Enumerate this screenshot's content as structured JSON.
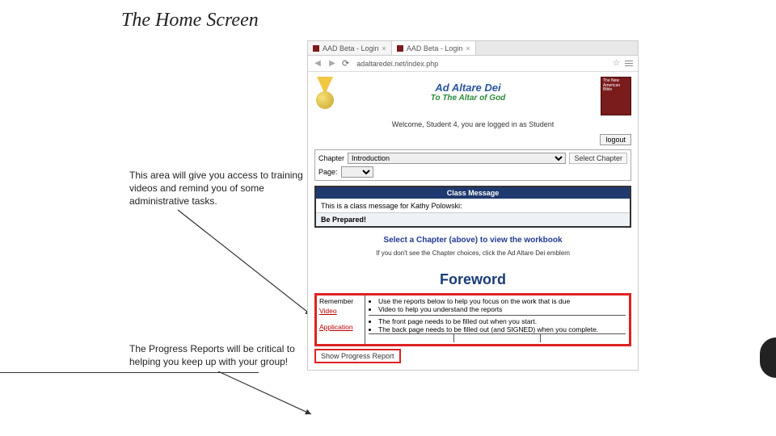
{
  "slide": {
    "title": "The Home Screen",
    "annotations": {
      "training": "This area will give you access to training videos and remind you of some administrative tasks.",
      "progress": "The Progress Reports will be critical to helping you keep up with your group!"
    }
  },
  "browser": {
    "tabs": [
      {
        "label": "AAD Beta - Login",
        "active": false
      },
      {
        "label": "AAD Beta - Login",
        "active": true
      }
    ],
    "url": "adaltaredei.net/index.php"
  },
  "site": {
    "title1": "Ad Altare Dei",
    "title2": "To The Altar of God",
    "bible_label": "The New American Bible",
    "welcome": "Welcome, Student 4, you are logged in as Student",
    "logout": "logout",
    "chapter_label": "Chapter",
    "chapter_value": "Introduction",
    "page_label": "Page:",
    "select_chapter_btn": "Select Chapter",
    "class_msg": {
      "header": "Class Message",
      "line1": "This is a class message for Kathy Polowski:",
      "line2": "Be Prepared!"
    },
    "hint": "Select a Chapter (above) to view the workbook",
    "hint_sub": "If you don't see the Chapter choices, click the Ad Altare Dei emblem",
    "foreword": "Foreword",
    "remember": {
      "label": "Remember",
      "video": "Video",
      "app": "Application",
      "bullets_top": [
        "Use the reports below to help you focus on the work that is due",
        "Video to help you understand the reports"
      ],
      "bullets_bot": [
        "The front page needs to be filled out when you start.",
        "The back page needs to be filled out (and SIGNED) when you complete."
      ]
    },
    "show_report": "Show Progress Report"
  }
}
